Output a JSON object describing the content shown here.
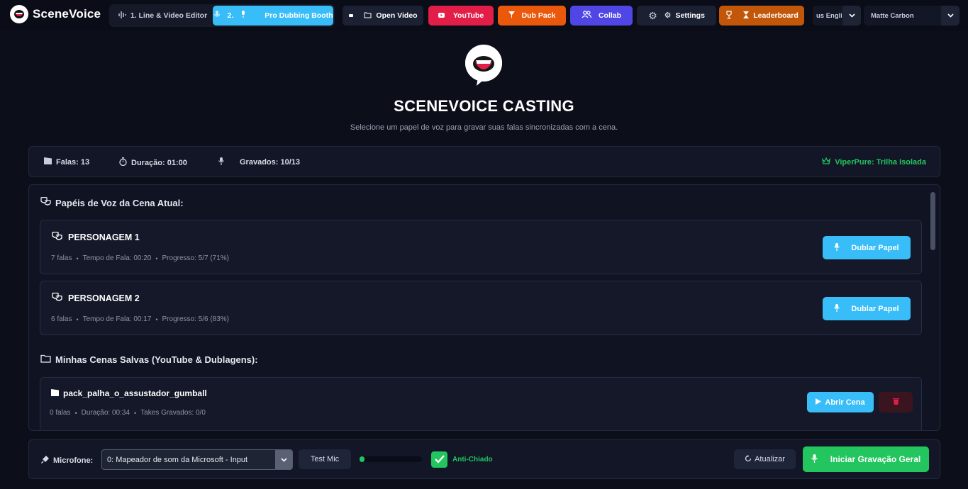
{
  "brand": {
    "name": "SceneVoice",
    "logo_icon": "speech-bubble-mouth-icon"
  },
  "nav": {
    "line_editor": "1. Line & Video Editor",
    "booth_number": "2.",
    "booth": "Pro Dubbing Booth",
    "open_video": "Open Video",
    "youtube": "YouTube",
    "dub_pack": "Dub Pack",
    "collab": "Collab",
    "settings": "Settings",
    "leaderboard": "Leaderboard",
    "language_value": "us English",
    "theme_value": "Matte Carbon"
  },
  "hero": {
    "title": "SCENEVOICE CASTING",
    "subtitle": "Selecione um papel de voz para gravar suas falas sincronizadas com a cena."
  },
  "stats": {
    "lines": "Falas: 13",
    "duration": "Duração: 01:00",
    "recorded": "Gravados: 10/13",
    "track": "ViperPure: Trilha Isolada"
  },
  "roles_section": {
    "title": "Papéis de Voz da Cena Atual:",
    "roles": [
      {
        "name": "PERSONAGEM 1",
        "lines": "7 falas",
        "speak_time": "Tempo de Fala: 00:20",
        "progress": "Progresso: 5/7 (71%)",
        "button": "Dublar Papel"
      },
      {
        "name": "PERSONAGEM 2",
        "lines": "6 falas",
        "speak_time": "Tempo de Fala: 00:17",
        "progress": "Progresso: 5/6 (83%)",
        "button": "Dublar Papel"
      }
    ]
  },
  "saved_section": {
    "title": "Minhas Cenas Salvas (YouTube & Dublagens):",
    "scenes": [
      {
        "name": "pack_palha_o_assustador_gumball",
        "lines": "0 falas",
        "duration": "Duração: 00:34",
        "takes": "Takes Gravados: 0/0",
        "open_button": "Abrir Cena"
      }
    ]
  },
  "bottom": {
    "mic_label": "Microfone:",
    "mic_value": "0: Mapeador de som da Microsoft - Input",
    "test_mic": "Test Mic",
    "mic_level": 0.08,
    "anti_noise": "Anti-Chiado",
    "anti_noise_checked": true,
    "refresh": "Atualizar",
    "record_all": "Iniciar Gravação Geral"
  },
  "colors": {
    "accent_blue": "#38bdf8",
    "green": "#22c55e",
    "youtube_red": "#e11d48",
    "orange": "#ea580c",
    "indigo": "#4f46e5"
  }
}
